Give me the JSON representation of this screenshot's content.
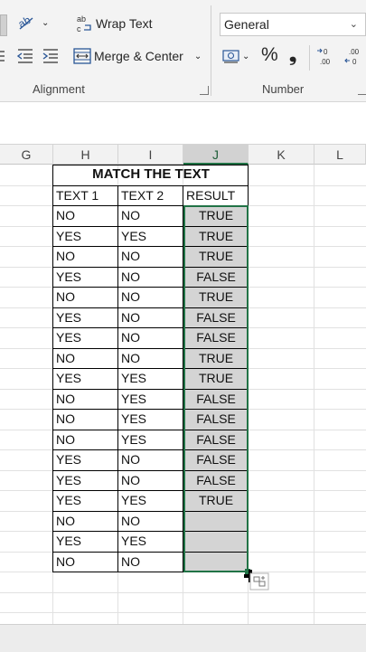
{
  "ribbon": {
    "wrap_text": "Wrap Text",
    "merge_center": "Merge & Center",
    "alignment_label": "Alignment",
    "number_format": "General",
    "currency_symbol": "%",
    "comma_symbol": "❟",
    "number_label": "Number"
  },
  "columns": [
    "G",
    "H",
    "I",
    "J",
    "K",
    "L"
  ],
  "table": {
    "title": "MATCH THE TEXT",
    "headers": [
      "TEXT 1",
      "TEXT 2",
      "RESULT"
    ],
    "rows": [
      [
        "NO",
        "NO",
        "TRUE"
      ],
      [
        "YES",
        "YES",
        "TRUE"
      ],
      [
        "NO",
        "NO",
        "TRUE"
      ],
      [
        "YES",
        "NO",
        "FALSE"
      ],
      [
        "NO",
        "NO",
        "TRUE"
      ],
      [
        "YES",
        "NO",
        "FALSE"
      ],
      [
        "YES",
        "NO",
        "FALSE"
      ],
      [
        "NO",
        "NO",
        "TRUE"
      ],
      [
        "YES",
        "YES",
        "TRUE"
      ],
      [
        "NO",
        "YES",
        "FALSE"
      ],
      [
        "NO",
        "YES",
        "FALSE"
      ],
      [
        "NO",
        "YES",
        "FALSE"
      ],
      [
        "YES",
        "NO",
        "FALSE"
      ],
      [
        "YES",
        "NO",
        "FALSE"
      ],
      [
        "YES",
        "YES",
        "TRUE"
      ],
      [
        "NO",
        "NO",
        ""
      ],
      [
        "YES",
        "YES",
        ""
      ],
      [
        "NO",
        "NO",
        ""
      ]
    ]
  },
  "colors": {
    "selection_green": "#217346",
    "selected_fill": "#d4d4d4"
  }
}
